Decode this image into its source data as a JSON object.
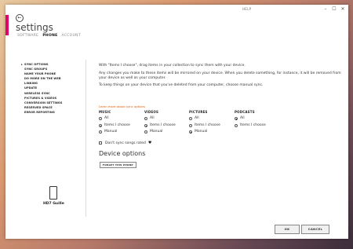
{
  "window": {
    "help_label": "HELP",
    "controls": [
      "–",
      "☐",
      "✕"
    ]
  },
  "header": {
    "title": "settings",
    "tabs": [
      "SOFTWARE",
      "PHONE",
      "ACCOUNT"
    ],
    "active_tab": "PHONE"
  },
  "sidebar": {
    "items": [
      "SYNC OPTIONS",
      "SYNC GROUPS",
      "NAME YOUR PHONE",
      "DO MORE ON THE WEB",
      "LINKING",
      "UPDATE",
      "WIRELESS SYNC",
      "PICTURES & VIDEOS",
      "CONVERSION SETTINGS",
      "RESERVED SPACE",
      "ERROR REPORTING"
    ],
    "selected": "SYNC OPTIONS",
    "phone_name": "HD7 Guille"
  },
  "main": {
    "para1": "With \"Items I choose\", drag items in your collection to sync them with your device.",
    "para2": "Any changes you make to these items will be mirrored on your device. When you delete something, for instance, it will be removed from your device as well as your computer.",
    "para3": "To keep things on your device that you've deleted from your computer, choose manual sync.",
    "learn_more": "Learn more about sync options",
    "columns": [
      {
        "header": "MUSIC",
        "options": [
          "All",
          "Items I choose",
          "Manual"
        ],
        "selected": "Items I choose"
      },
      {
        "header": "VIDEOS",
        "options": [
          "All",
          "Items I choose",
          "Manual"
        ],
        "selected": "Items I choose"
      },
      {
        "header": "PICTURES",
        "options": [
          "All",
          "Items I choose",
          "Manual"
        ],
        "selected": "Manual"
      },
      {
        "header": "PODCASTS",
        "options": [
          "All",
          "Items I choose"
        ],
        "selected": "All"
      }
    ],
    "dont_sync_label": "Don't sync songs rated",
    "device_options_title": "Device options",
    "forget_button": "FORGET THIS PHONE"
  },
  "footer": {
    "ok_label": "OK",
    "cancel_label": "CANCEL"
  },
  "colors": {
    "accent": "#e0006e",
    "link": "#e05a00"
  }
}
